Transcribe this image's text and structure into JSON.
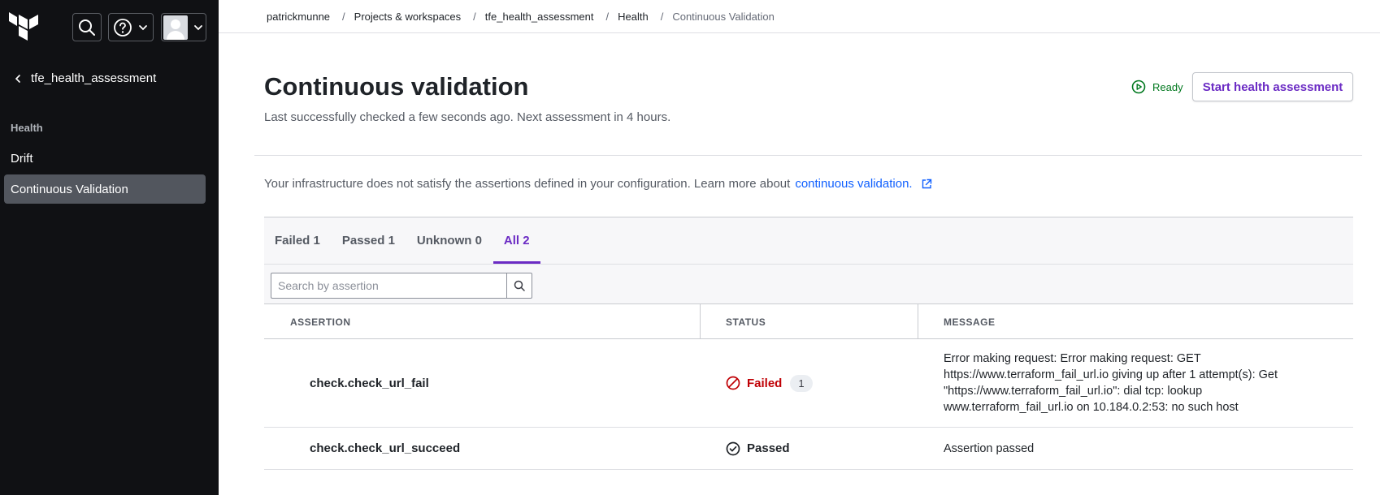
{
  "sidebar": {
    "back_label": "tfe_health_assessment",
    "section_heading": "Health",
    "items": [
      {
        "label": "Drift"
      },
      {
        "label": "Continuous Validation"
      }
    ]
  },
  "breadcrumb": [
    "patrickmunne",
    "Projects & workspaces",
    "tfe_health_assessment",
    "Health",
    "Continuous Validation"
  ],
  "header": {
    "title": "Continuous validation",
    "subtitle": "Last successfully checked a few seconds ago. Next assessment in 4 hours.",
    "status_label": "Ready",
    "start_button": "Start health assessment"
  },
  "info": {
    "text": "Your infrastructure does not satisfy the assertions defined in your configuration. Learn more about",
    "link": "continuous validation."
  },
  "tabs": [
    {
      "label": "Failed 1"
    },
    {
      "label": "Passed 1"
    },
    {
      "label": "Unknown 0"
    },
    {
      "label": "All 2"
    }
  ],
  "search": {
    "placeholder": "Search by assertion"
  },
  "table": {
    "columns": [
      "ASSERTION",
      "STATUS",
      "MESSAGE"
    ],
    "rows": [
      {
        "assertion": "check.check_url_fail",
        "status": "Failed",
        "count": "1",
        "message": "Error making request: Error making request: GET https://www.terraform_fail_url.io giving up after 1 attempt(s): Get \"https://www.terraform_fail_url.io\": dial tcp: lookup www.terraform_fail_url.io on 10.184.0.2:53: no such host"
      },
      {
        "assertion": "check.check_url_succeed",
        "status": "Passed",
        "message": "Assertion passed"
      }
    ]
  },
  "colors": {
    "sidebar_bg": "#101114",
    "accent": "#6b2bc4",
    "link": "#1060ff",
    "failed": "#c00005",
    "ready": "#00781e"
  }
}
